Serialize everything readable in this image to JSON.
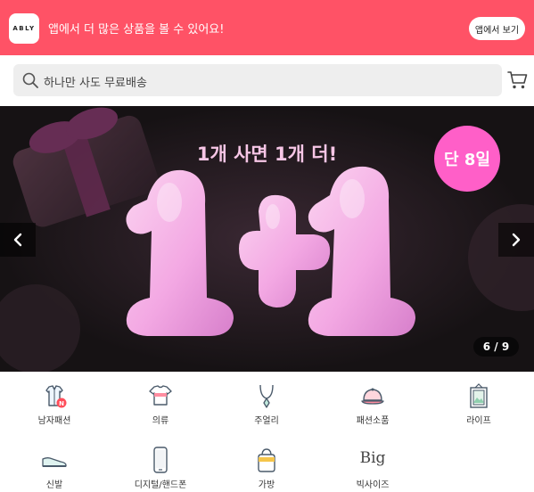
{
  "app_banner": {
    "logo_text": "ABLY",
    "message": "앱에서 더 많은 상품을 볼 수 있어요!",
    "open_app_label": "앱에서 보기",
    "background_color": "#ff5266"
  },
  "search": {
    "placeholder": "하나만 사도 무료배송",
    "icon": "search-icon"
  },
  "header": {
    "cart_icon": "cart-icon"
  },
  "hero": {
    "headline": "1개 사면 1개 더!",
    "badge": "단 8일",
    "big_text": "1+1",
    "counter": "6 / 9",
    "prev_icon": "chevron-left-icon",
    "next_icon": "chevron-right-icon",
    "badge_color": "#ff5fc8"
  },
  "categories": [
    {
      "label": "남자패션",
      "icon": "shirt-icon",
      "new_badge": "N"
    },
    {
      "label": "의류",
      "icon": "tshirt-icon"
    },
    {
      "label": "주얼리",
      "icon": "necklace-icon"
    },
    {
      "label": "패션소품",
      "icon": "cap-icon"
    },
    {
      "label": "라이프",
      "icon": "picture-frame-icon"
    },
    {
      "label": "신발",
      "icon": "shoe-icon"
    },
    {
      "label": "디지털/핸드폰",
      "icon": "phone-icon"
    },
    {
      "label": "가방",
      "icon": "bag-icon"
    },
    {
      "label": "빅사이즈",
      "icon": "big-size-icon",
      "icon_text": "Big"
    }
  ]
}
